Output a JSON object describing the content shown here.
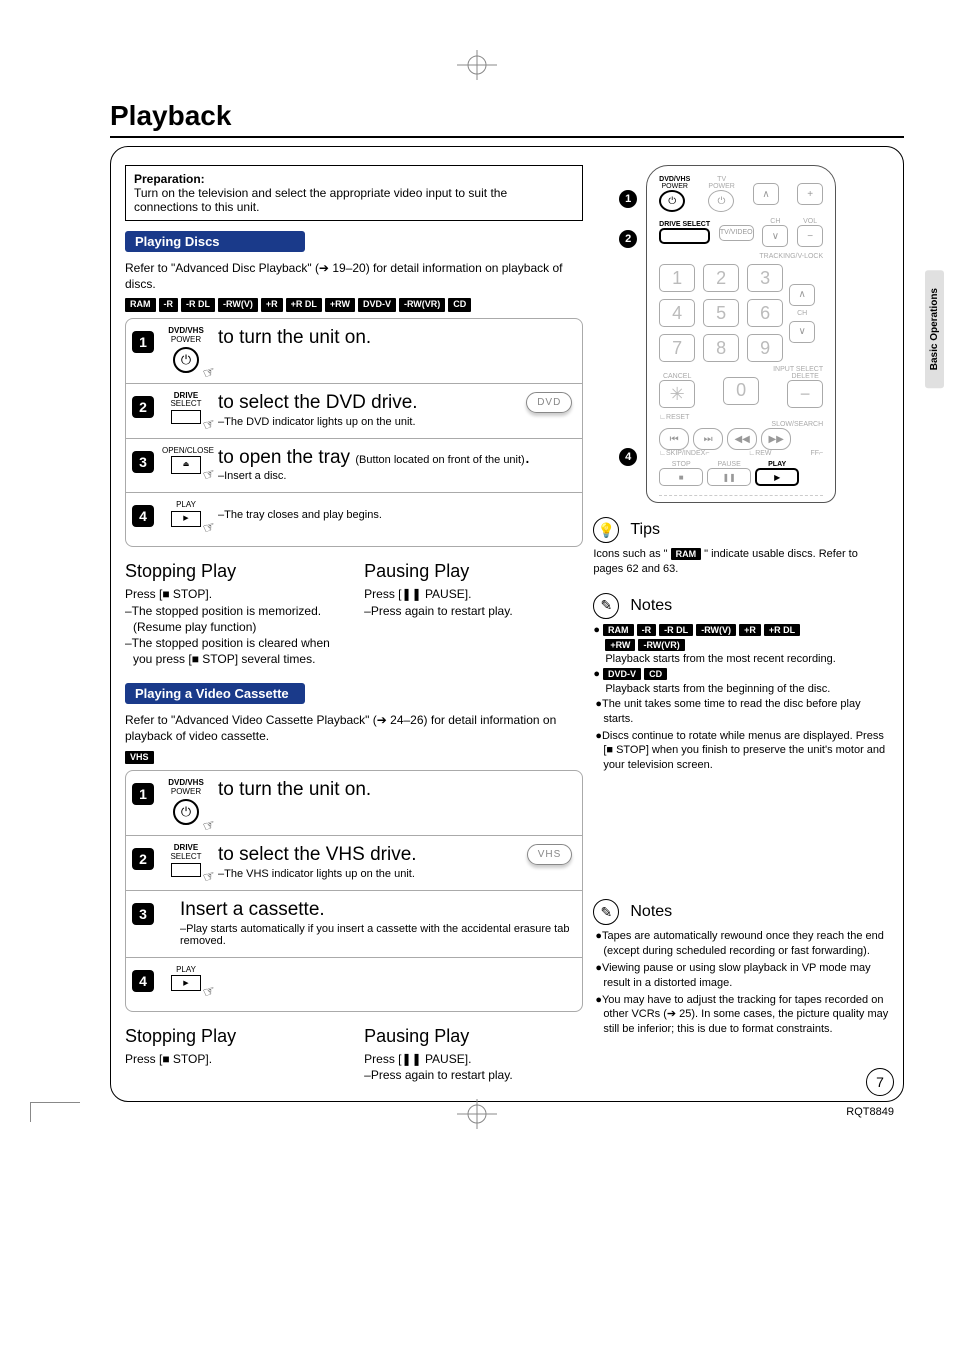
{
  "title": "Playback",
  "sideTab": "Basic Operations",
  "pageNumber": "7",
  "footerCode": "RQT8849",
  "preparation": {
    "heading": "Preparation:",
    "text": "Turn on the television and select the appropriate video input to suit the connections to this unit."
  },
  "discs": {
    "sectionTitle": "Playing Discs",
    "intro": "Refer to \"Advanced Disc Playback\" (➔ 19–20) for detail information on playback of discs.",
    "formats": [
      "RAM",
      "-R",
      "-R DL",
      "-RW(V)",
      "+R",
      "+R DL",
      "+RW",
      "DVD-V",
      "-RW(VR)",
      "CD"
    ],
    "steps": [
      {
        "iconTop": "DVD/VHS",
        "iconSub": "POWER",
        "iconGlyph": "⏻",
        "action": "to turn the unit on."
      },
      {
        "iconTop": "DRIVE",
        "iconSub": "SELECT",
        "iconRect": true,
        "action": "to select the DVD drive.",
        "note": "–The DVD indicator lights up on the unit.",
        "pill": "DVD"
      },
      {
        "iconTop": "OPEN/CLOSE",
        "iconGlyph": "⏏",
        "actionPrefix": "to open the tray ",
        "actionSmall": "(Button located on front of the unit)",
        "actionSuffix": ".",
        "note": "–Insert a disc."
      },
      {
        "iconTop": "PLAY",
        "iconGlyph": "▶",
        "rectPlay": true,
        "noteOnly": "–The tray closes and play begins."
      }
    ],
    "stopping": {
      "title": "Stopping Play",
      "lines": [
        "Press [■ STOP].",
        "–The stopped position is memorized. (Resume play function)",
        "–The stopped position is cleared when you press [■ STOP] several times."
      ]
    },
    "pausing": {
      "title": "Pausing Play",
      "lines": [
        "Press [❚❚ PAUSE].",
        "–Press again to restart play."
      ]
    }
  },
  "vhs": {
    "sectionTitle": "Playing a Video Cassette",
    "intro": "Refer to \"Advanced Video Cassette Playback\" (➔ 24–26) for detail information on playback of video cassette.",
    "formats": [
      "VHS"
    ],
    "steps": [
      {
        "iconTop": "DVD/VHS",
        "iconSub": "POWER",
        "iconGlyph": "⏻",
        "action": "to turn the unit on."
      },
      {
        "iconTop": "DRIVE",
        "iconSub": "SELECT",
        "iconRect": true,
        "action": "to select the VHS drive.",
        "note": "–The VHS indicator lights up on the unit.",
        "pill": "VHS"
      },
      {
        "noIcon": true,
        "action": "Insert a cassette.",
        "note": "–Play starts automatically if you insert a cassette with the accidental erasure tab removed."
      },
      {
        "iconTop": "PLAY",
        "iconGlyph": "▶",
        "rectPlay": true
      }
    ],
    "stopping": {
      "title": "Stopping Play",
      "lines": [
        "Press [■ STOP]."
      ]
    },
    "pausing": {
      "title": "Pausing Play",
      "lines": [
        "Press [❚❚ PAUSE].",
        "–Press again to restart play."
      ]
    }
  },
  "remote": {
    "power": {
      "label": "DVD/VHS",
      "sub": "POWER"
    },
    "driveSelect": "DRIVE SELECT",
    "tv": "TV",
    "tvPower": "POWER",
    "tvVideo": "TV/VIDEO",
    "ch": "CH",
    "vol": "VOL",
    "tracking": "TRACKING/V-LOCK",
    "inputSelect": "INPUT SELECT",
    "cancel": "CANCEL",
    "reset": "RESET",
    "delete": "DELETE",
    "slow": "SLOW/SEARCH",
    "skip": "SKIP/INDEX",
    "rew": "REW",
    "ff": "FF",
    "stop": "STOP",
    "pause": "PAUSE",
    "play": "PLAY",
    "nums": [
      "1",
      "2",
      "3",
      "4",
      "5",
      "6",
      "7",
      "8",
      "9",
      "0"
    ]
  },
  "tips": {
    "heading": "Tips",
    "pre": "Icons such as \" ",
    "chip": "RAM",
    "post": " \" indicate usable discs. Refer to pages 62 and 63."
  },
  "notes1": {
    "heading": "Notes",
    "row1chips": [
      "RAM",
      "-R",
      "-R DL",
      "-RW(V)",
      "+R",
      "+R DL"
    ],
    "row2chips": [
      "+RW",
      "-RW(VR)"
    ],
    "line1": "Playback starts from the most recent recording.",
    "row3chips": [
      "DVD-V",
      "CD"
    ],
    "line2": "Playback starts from the beginning of the disc.",
    "bullets": [
      "The unit takes some time to read the disc before play starts.",
      "Discs continue to rotate while menus are displayed. Press [■ STOP] when you finish to preserve the unit's motor and your television screen."
    ]
  },
  "notes2": {
    "heading": "Notes",
    "bullets": [
      "Tapes are automatically rewound once they reach the end (except during scheduled recording or fast forwarding).",
      "Viewing pause or using slow playback in VP mode may result in a distorted image.",
      "You may have to adjust the tracking for tapes recorded on other VCRs (➔ 25). In some cases, the picture quality may still be inferior; this is due to format constraints."
    ]
  }
}
